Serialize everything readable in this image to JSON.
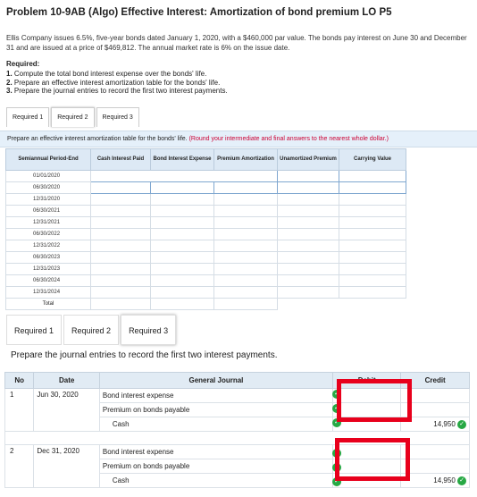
{
  "title": "Problem 10-9AB (Algo) Effective Interest: Amortization of bond premium LO P5",
  "description": "Ellis Company issues 6.5%, five-year bonds dated January 1, 2020, with a $460,000 par value. The bonds pay interest on June 30 and December 31 and are issued at a price of $469,812. The annual market rate is 6% on the issue date.",
  "required_heading": "Required:",
  "required_items": [
    {
      "num": "1.",
      "text": "Compute the total bond interest expense over the bonds' life."
    },
    {
      "num": "2.",
      "text": "Prepare an effective interest amortization table for the bonds' life."
    },
    {
      "num": "3.",
      "text": "Prepare the journal entries to record the first two interest payments."
    }
  ],
  "tabs": [
    "Required 1",
    "Required 2",
    "Required 3"
  ],
  "instruction": "Prepare an effective interest amortization table for the bonds' life.",
  "instruction_note": "(Round your intermediate and final answers to the nearest whole dollar.)",
  "amort_table": {
    "headers": [
      "Semiannual Period-End",
      "Cash Interest Paid",
      "Bond Interest Expense",
      "Premium Amortization",
      "Unamortized Premium",
      "Carrying Value"
    ],
    "rows": [
      "01/01/2020",
      "06/30/2020",
      "12/31/2020",
      "06/30/2021",
      "12/31/2021",
      "06/30/2022",
      "12/31/2022",
      "06/30/2023",
      "12/31/2023",
      "06/30/2024",
      "12/31/2024"
    ],
    "total_label": "Total"
  },
  "journal_instruction": "Prepare the journal entries to record the first two interest payments.",
  "journal": {
    "headers": [
      "No",
      "Date",
      "General Journal",
      "Debit",
      "Credit"
    ],
    "entries": [
      {
        "no": "1",
        "date": "Jun 30, 2020",
        "lines": [
          {
            "account": "Bond interest expense",
            "credit": ""
          },
          {
            "account": "Premium on bonds payable",
            "credit": ""
          },
          {
            "account": "Cash",
            "credit": "14,950"
          }
        ]
      },
      {
        "no": "2",
        "date": "Dec 31, 2020",
        "lines": [
          {
            "account": "Bond interest expense",
            "credit": ""
          },
          {
            "account": "Premium on bonds payable",
            "credit": ""
          },
          {
            "account": "Cash",
            "credit": "14,950"
          }
        ]
      }
    ]
  },
  "colors": {
    "check": "#27a844",
    "highlight": "#e8001c",
    "header_bg": "#dde9f5"
  }
}
